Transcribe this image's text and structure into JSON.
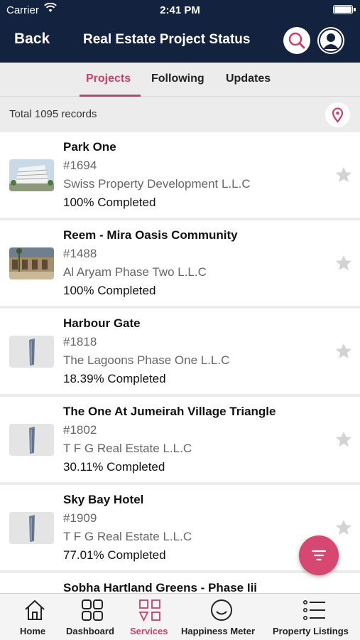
{
  "status_bar": {
    "carrier": "Carrier",
    "time": "2:41 PM"
  },
  "header": {
    "back_label": "Back",
    "title": "Real Estate Project Status"
  },
  "tabs": [
    {
      "label": "Projects",
      "active": true
    },
    {
      "label": "Following",
      "active": false
    },
    {
      "label": "Updates",
      "active": false
    }
  ],
  "records": {
    "total_text": "Total 1095 records"
  },
  "projects": [
    {
      "name": "Park One",
      "number": "#1694",
      "developer": "Swiss Property Development L.L.C",
      "completion": "100% Completed",
      "thumb": "building-photo"
    },
    {
      "name": "Reem - Mira Oasis Community",
      "number": "#1488",
      "developer": "Al Aryam Phase Two L.L.C",
      "completion": "100% Completed",
      "thumb": "community-photo"
    },
    {
      "name": "Harbour Gate",
      "number": "#1818",
      "developer": "The Lagoons Phase One L.L.C",
      "completion": "18.39% Completed",
      "thumb": "tower-placeholder"
    },
    {
      "name": "The One At Jumeirah Village Triangle",
      "number": "#1802",
      "developer": "T F G Real Estate L.L.C",
      "completion": "30.11% Completed",
      "thumb": "tower-placeholder"
    },
    {
      "name": "Sky Bay Hotel",
      "number": "#1909",
      "developer": "T F G Real Estate L.L.C",
      "completion": "77.01% Completed",
      "thumb": "tower-placeholder"
    },
    {
      "name": "Sobha Hartland Greens - Phase Iii",
      "number": "",
      "developer": "",
      "completion": "",
      "thumb": ""
    }
  ],
  "bottom_nav": [
    {
      "label": "Home",
      "icon": "home-icon",
      "active": false
    },
    {
      "label": "Dashboard",
      "icon": "dashboard-icon",
      "active": false
    },
    {
      "label": "Services",
      "icon": "services-icon",
      "active": true
    },
    {
      "label": "Happiness Meter",
      "icon": "smiley-icon",
      "active": false
    },
    {
      "label": "Property Listings",
      "icon": "list-icon",
      "active": false
    }
  ],
  "colors": {
    "header_bg": "#13223f",
    "accent": "#c8416a",
    "fab": "#d64772"
  }
}
